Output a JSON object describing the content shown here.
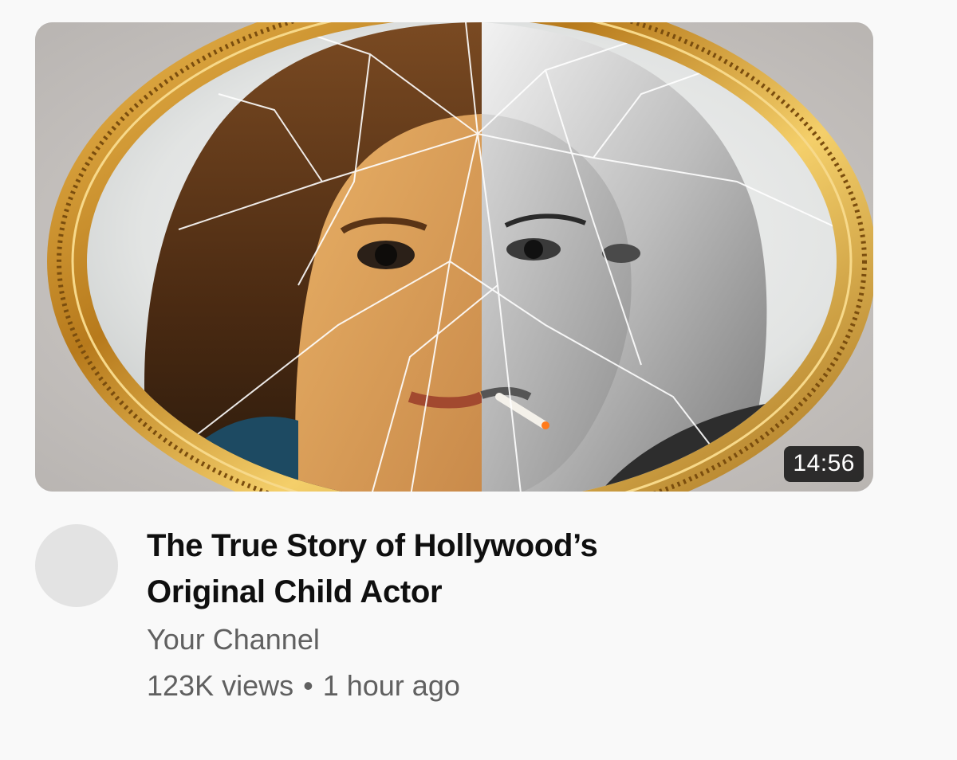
{
  "video": {
    "title": "The True Story of Hollywood’s Original Child Actor",
    "channel": "Your Channel",
    "views": "123K views",
    "separator": "•",
    "age": "1 hour ago",
    "duration": "14:56"
  },
  "colors": {
    "background": "#f9f9f9",
    "title": "#0f0f0f",
    "secondary_text": "#606060",
    "avatar_placeholder": "#e3e3e3",
    "frame_gold": "#d9a23a",
    "duration_badge_bg": "#141414"
  }
}
